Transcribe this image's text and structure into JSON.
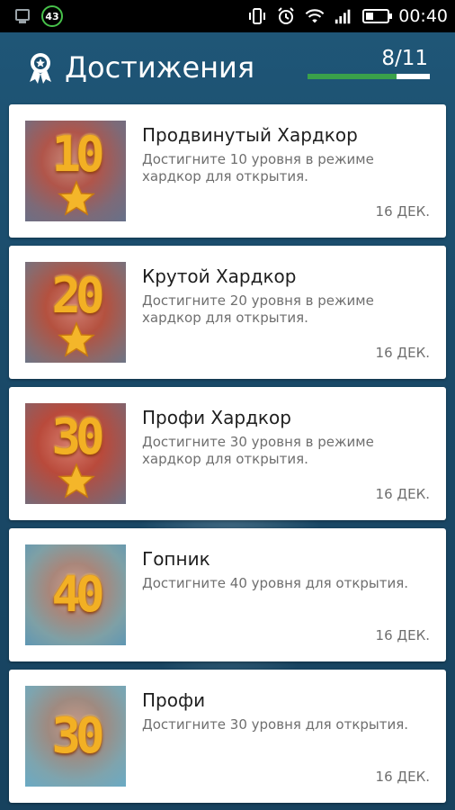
{
  "status_bar": {
    "notification_count": "43",
    "time": "00:40",
    "battery_level": 0.3
  },
  "header": {
    "title": "Достижения",
    "progress_text": "8/11",
    "progress_value": 0.73
  },
  "achievements": [
    {
      "title": "Продвинутый Хардкор",
      "description": "Достигните 10 уровня в режиме хардкор для открытия.",
      "date": "16 ДЕК.",
      "badge_number": "10",
      "has_star": true
    },
    {
      "title": "Крутой Хардкор",
      "description": "Достигните 20 уровня в режиме хардкор для открытия.",
      "date": "16 ДЕК.",
      "badge_number": "20",
      "has_star": true
    },
    {
      "title": "Профи Хардкор",
      "description": "Достигните 30 уровня в режиме хардкор для открытия.",
      "date": "16 ДЕК.",
      "badge_number": "30",
      "has_star": true
    },
    {
      "title": "Гопник",
      "description": "Достигните 40 уровня для открытия.",
      "date": "16 ДЕК.",
      "badge_number": "40",
      "has_star": false
    },
    {
      "title": "Профи",
      "description": "Достигните 30 уровня для открытия.",
      "date": "16 ДЕК.",
      "badge_number": "30",
      "has_star": false
    }
  ],
  "colors": {
    "header_bg": "#1b4f70",
    "progress_fill": "#3aa14a",
    "badge_gold": "#f2b024"
  }
}
